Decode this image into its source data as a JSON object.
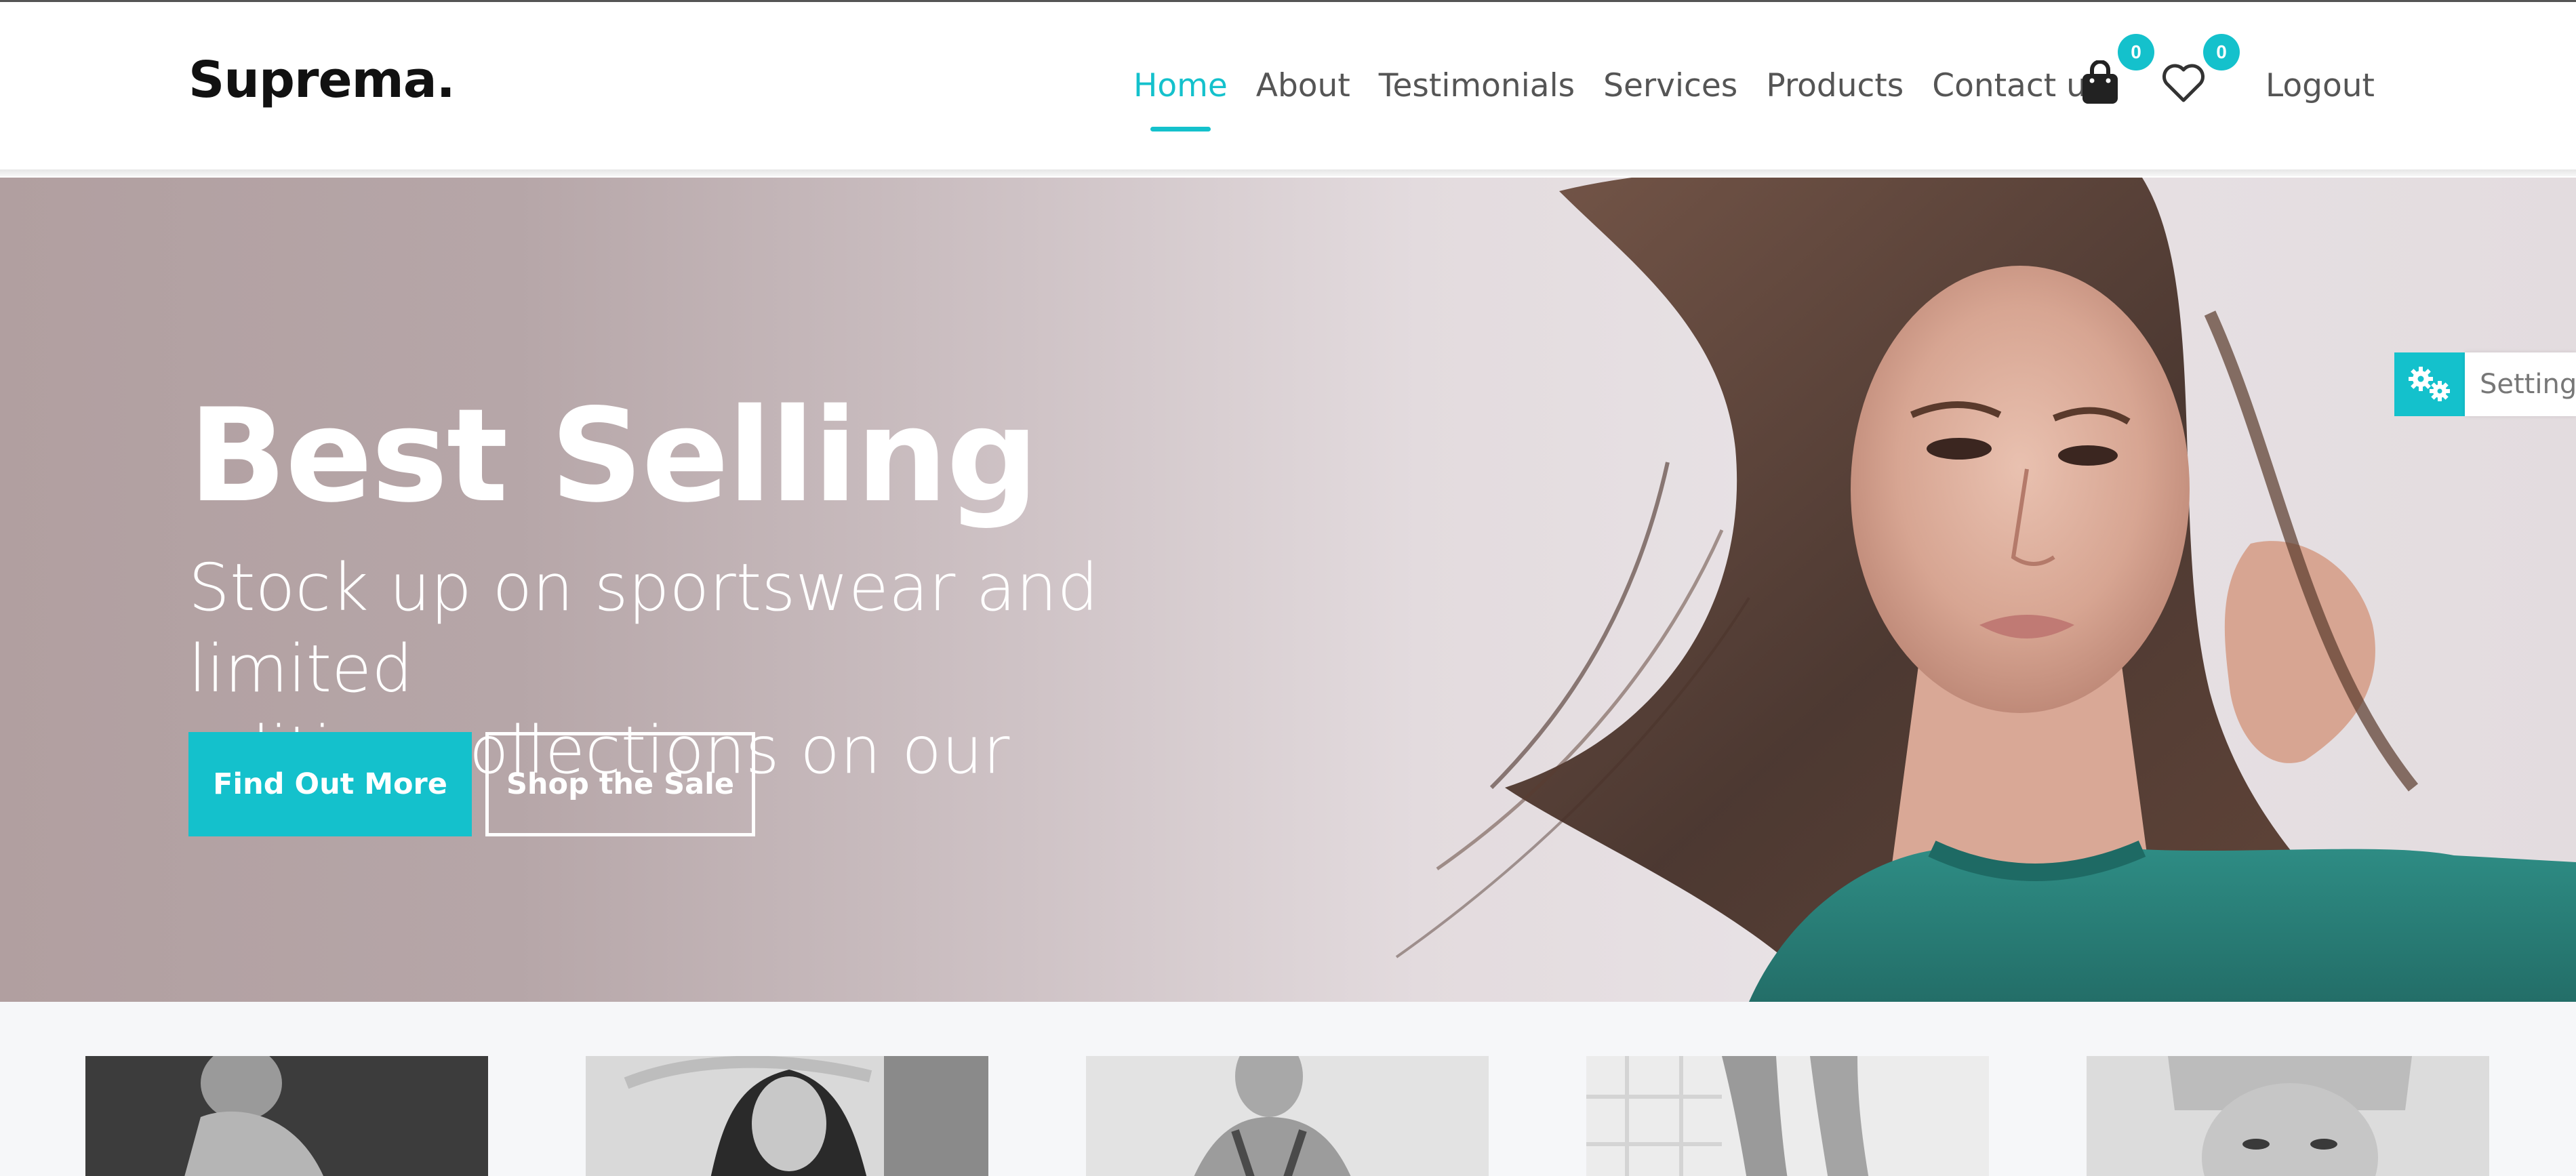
{
  "brand": {
    "name": "Suprema."
  },
  "nav": {
    "items": [
      {
        "label": "Home",
        "active": true
      },
      {
        "label": "About",
        "active": false
      },
      {
        "label": "Testimonials",
        "active": false
      },
      {
        "label": "Services",
        "active": false
      },
      {
        "label": "Products",
        "active": false
      },
      {
        "label": "Contact us",
        "active": false
      }
    ],
    "cart_count": "0",
    "wishlist_count": "0",
    "logout_label": "Logout",
    "cart_icon": "shopping-bag-icon",
    "wishlist_icon": "heart-icon"
  },
  "hero": {
    "title": "Best Selling",
    "subtitle_line1": "Stock up on sportswear and limited",
    "subtitle_line2": "edition collections on our",
    "primary_button": "Find Out More",
    "secondary_button": "Shop the Sale"
  },
  "settings": {
    "label": "Settings",
    "icon": "gears-icon"
  },
  "colors": {
    "accent": "#14c1cc",
    "brand_text": "#111111",
    "nav_text": "#555555"
  }
}
